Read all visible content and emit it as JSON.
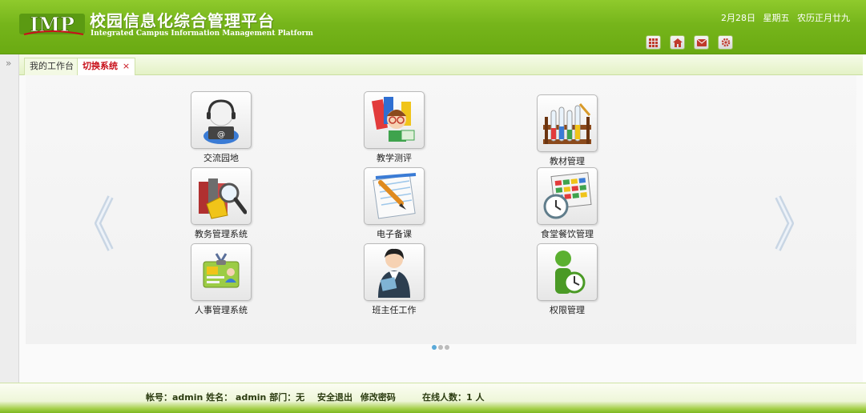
{
  "header": {
    "logo_text": "IMP",
    "title_cn": "校园信息化综合管理平台",
    "title_en": "Integrated Campus Information Management Platform",
    "date": "2月28日",
    "weekday": "星期五",
    "lunar": "农历正月廿九",
    "icons": [
      "apps-icon",
      "home-icon",
      "mail-icon",
      "settings-icon"
    ]
  },
  "tabs": [
    {
      "label": "我的工作台",
      "active": false
    },
    {
      "label": "切换系统",
      "active": true,
      "close": "×"
    }
  ],
  "rail": {
    "toggle": "»"
  },
  "apps": [
    {
      "label": "交流园地",
      "icon": "support-agent-icon"
    },
    {
      "label": "教学测评",
      "icon": "teacher-books-icon"
    },
    {
      "label": "教材管理",
      "icon": "test-tube-rack-icon"
    },
    {
      "label": "教务管理系统",
      "icon": "books-magnifier-icon"
    },
    {
      "label": "电子备课",
      "icon": "notepad-pen-icon"
    },
    {
      "label": "食堂餐饮管理",
      "icon": "calendar-clock-icon"
    },
    {
      "label": "人事管理系统",
      "icon": "id-badge-icon"
    },
    {
      "label": "班主任工作",
      "icon": "staff-person-icon"
    },
    {
      "label": "权限管理",
      "icon": "user-clock-icon"
    }
  ],
  "pager": {
    "pages": 3,
    "current": 1
  },
  "footer": {
    "account": "帐号：admin 姓名： admin 部门：无",
    "logout": "安全退出",
    "change_password": "修改密码",
    "online": "在线人数：1 人"
  },
  "colors": {
    "header_green": "#76b51b",
    "active_tab_red": "#c8101a",
    "pager_active": "#5aa9d8"
  }
}
